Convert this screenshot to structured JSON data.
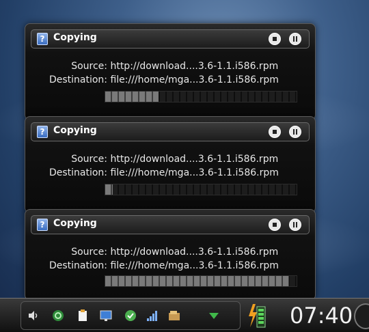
{
  "jobs": [
    {
      "title": "Copying",
      "source_label": "Source:",
      "source_value": "http://download....3.6-1.1.i586.rpm",
      "dest_label": "Destination:",
      "dest_value": "file:///home/mga...3.6-1.1.i586.rpm",
      "progress": 0.28
    },
    {
      "title": "Copying",
      "source_label": "Source:",
      "source_value": "http://download....3.6-1.1.i586.rpm",
      "dest_label": "Destination:",
      "dest_value": "file:///home/mga...3.6-1.1.i586.rpm",
      "progress": 0.04
    },
    {
      "title": "Copying",
      "source_label": "Source:",
      "source_value": "http://download....3.6-1.1.i586.rpm",
      "dest_label": "Destination:",
      "dest_value": "file:///home/mga...3.6-1.1.i586.rpm",
      "progress": 0.96
    }
  ],
  "taskbar": {
    "clock": "07:40",
    "icons": [
      "speaker-icon",
      "sync-icon",
      "clipboard-icon",
      "display-icon",
      "check-icon",
      "signal-icon",
      "wallet-icon",
      "expand-icon",
      "battery-icon"
    ]
  },
  "colors": {
    "fill": "#7a7a7a",
    "empty": "#1d1d1d"
  }
}
